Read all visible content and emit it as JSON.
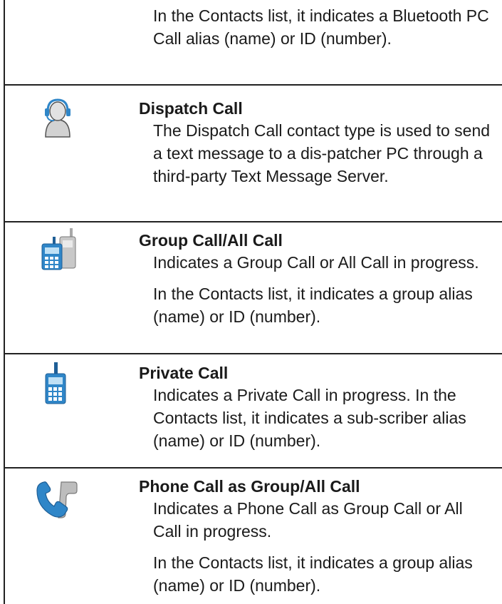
{
  "rows": [
    {
      "title": "",
      "paragraphs": [
        "In the Contacts list, it indicates a Bluetooth PC Call alias (name) or ID (number)."
      ]
    },
    {
      "icon": "dispatch-headset-icon",
      "title": "Dispatch Call",
      "paragraphs": [
        "The Dispatch Call contact type is used to send a text message to a dis-patcher PC through a third-party Text Message Server."
      ]
    },
    {
      "icon": "group-radios-icon",
      "title": "Group Call/All Call",
      "paragraphs": [
        "Indicates a Group Call or All Call in progress.",
        "In the Contacts list, it indicates a group alias (name) or ID (number)."
      ]
    },
    {
      "icon": "private-radio-icon",
      "title": "Private Call",
      "paragraphs": [
        "Indicates a Private Call in progress. In the Contacts list, it indicates a sub-scriber alias (name) or ID (number)."
      ]
    },
    {
      "icon": "phone-group-handset-icon",
      "title": "Phone Call as Group/All Call",
      "paragraphs": [
        "Indicates a Phone Call as Group Call or All Call in progress.",
        "In the Contacts list, it indicates a group alias (name) or ID (number)."
      ]
    }
  ],
  "colors": {
    "rule": "#222222",
    "icon_blue": "#2f86c8",
    "icon_grey": "#b5b5b5",
    "text": "#1a1a1a"
  }
}
